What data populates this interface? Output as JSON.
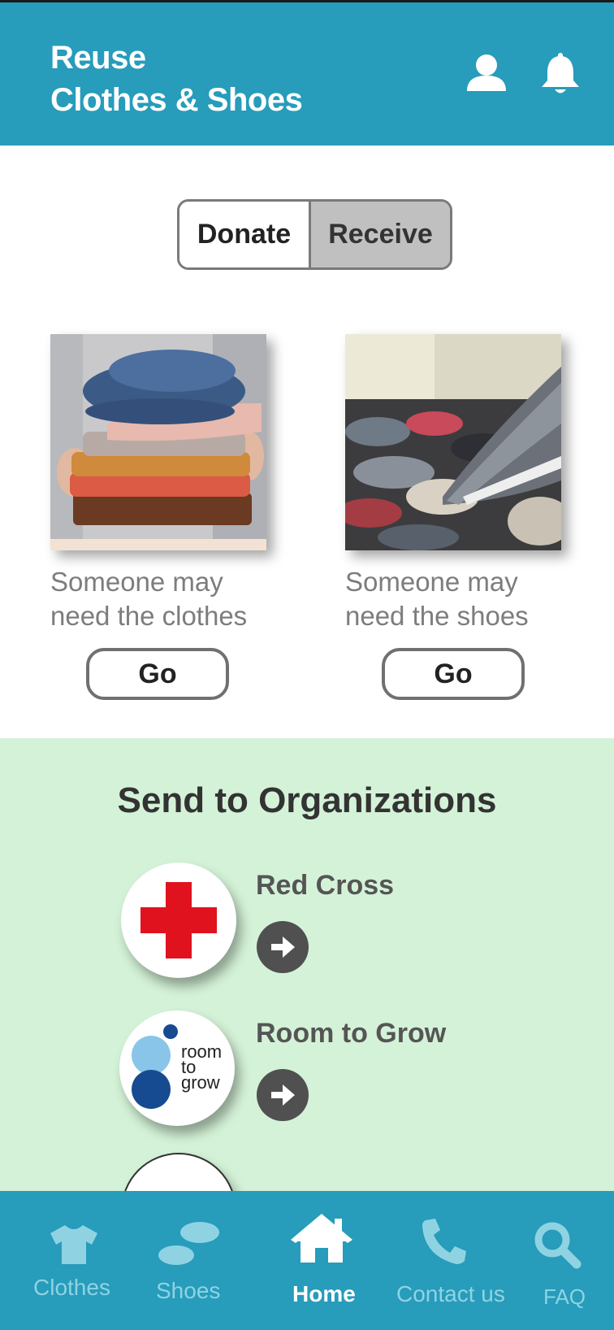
{
  "header": {
    "title_line1": "Reuse",
    "title_line2": "Clothes & Shoes",
    "icons": [
      "user-icon",
      "bell-icon"
    ]
  },
  "mode_toggle": {
    "options": [
      "Donate",
      "Receive"
    ],
    "selected": "Receive"
  },
  "cards": [
    {
      "line1": "Someone may",
      "line2": "need the clothes",
      "button": "Go"
    },
    {
      "line1": "Someone may",
      "line2": "need the shoes",
      "button": "Go"
    }
  ],
  "organizations": {
    "title": "Send to Organizations",
    "items": [
      {
        "name": "Red Cross"
      },
      {
        "name": "Room to Grow",
        "logo_text": [
          "room",
          "to",
          "grow"
        ]
      }
    ]
  },
  "bottom_nav": {
    "items": [
      {
        "label": "Clothes",
        "icon": "tshirt-icon"
      },
      {
        "label": "Shoes",
        "icon": "footprints-icon"
      },
      {
        "label": "Home",
        "icon": "home-icon"
      },
      {
        "label": "Contact us",
        "icon": "phone-icon"
      },
      {
        "label": "FAQ",
        "icon": "search-icon"
      }
    ],
    "active": "Home"
  },
  "colors": {
    "primary": "#279cbb",
    "org_section_bg": "#d4f2d7",
    "red_cross": "#e0121e",
    "nav_inactive": "#8fd3e3"
  }
}
